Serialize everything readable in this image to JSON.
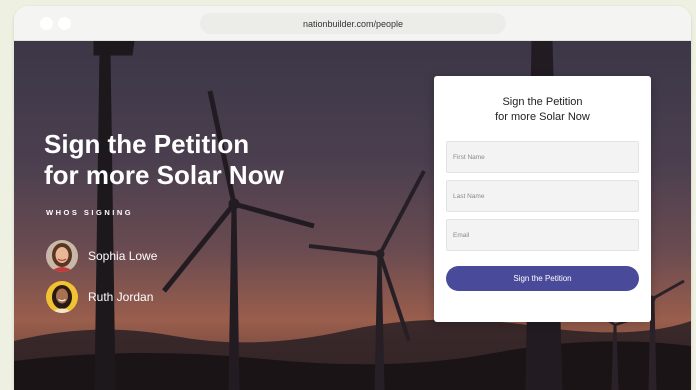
{
  "browser": {
    "url": "nationbuilder.com/people"
  },
  "hero": {
    "headline_line1": "Sign the Petition",
    "headline_line2": "for more Solar Now",
    "signing_label": "WHOS SIGNING",
    "signers": [
      {
        "name": "Sophia Lowe"
      },
      {
        "name": "Ruth Jordan"
      }
    ]
  },
  "form": {
    "title_line1": "Sign the Petition",
    "title_line2": "for more Solar Now",
    "first_name_placeholder": "First Name",
    "last_name_placeholder": "Last Name",
    "email_placeholder": "Email",
    "submit_label": "Sign the Petition"
  },
  "colors": {
    "button": "#4a4a9a",
    "sky_top": "#3b3747",
    "sky_horizon": "#9a5e4c"
  }
}
